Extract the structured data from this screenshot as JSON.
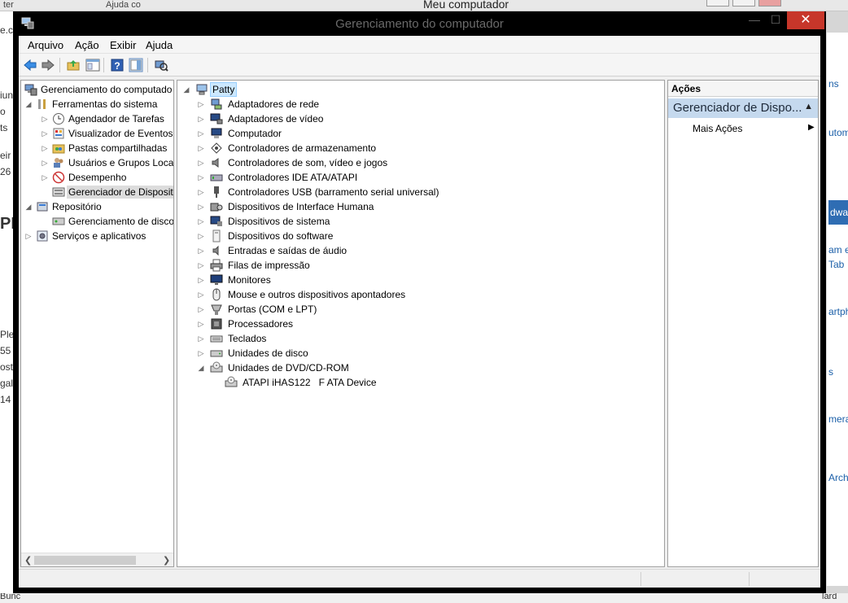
{
  "background": {
    "title": "Meu computador",
    "tabs": [
      "ter",
      "Ajuda co"
    ],
    "left_fragments": [
      "e.c",
      "iun",
      "o",
      "ts",
      "eir",
      "26",
      "PK",
      "Ple",
      "55",
      "ost",
      "gal",
      "14"
    ],
    "right_fragments": [
      "ns",
      "utom",
      "dwa",
      "am e",
      "Tab",
      "artph",
      "s",
      "mera",
      "Arch"
    ],
    "bottom_fragments": [
      "Bunc",
      "lard"
    ]
  },
  "window": {
    "title": "Gerenciamento do computador",
    "close_label": "✕",
    "minimize_label": "—",
    "maximize_label": "☐"
  },
  "menu": [
    "Arquivo",
    "Ação",
    "Exibir",
    "Ajuda"
  ],
  "tree": {
    "root": "Gerenciamento do computado",
    "items": [
      {
        "label": "Ferramentas do sistema",
        "level": 1,
        "exp": "▲",
        "icon": "tools-icon"
      },
      {
        "label": "Agendador de Tarefas",
        "level": 2,
        "exp": "▷",
        "icon": "clock-icon"
      },
      {
        "label": "Visualizador de Eventos",
        "level": 2,
        "exp": "▷",
        "icon": "event-viewer-icon"
      },
      {
        "label": "Pastas compartilhadas",
        "level": 2,
        "exp": "▷",
        "icon": "shared-folder-icon"
      },
      {
        "label": "Usuários e Grupos Loca",
        "level": 2,
        "exp": "▷",
        "icon": "users-icon"
      },
      {
        "label": "Desempenho",
        "level": 2,
        "exp": "▷",
        "icon": "performance-icon"
      },
      {
        "label": "Gerenciador de Disposit",
        "level": 2,
        "exp": "",
        "icon": "device-manager-icon",
        "selected": true
      },
      {
        "label": "Repositório",
        "level": 1,
        "exp": "▲",
        "icon": "storage-icon"
      },
      {
        "label": "Gerenciamento de disco",
        "level": 2,
        "exp": "",
        "icon": "disk-management-icon"
      },
      {
        "label": "Serviços e aplicativos",
        "level": 1,
        "exp": "▷",
        "icon": "services-icon"
      }
    ]
  },
  "devices": {
    "root": "Patty",
    "categories": [
      {
        "label": "Adaptadores de rede",
        "icon": "network-adapter-icon"
      },
      {
        "label": "Adaptadores de vídeo",
        "icon": "display-adapter-icon"
      },
      {
        "label": "Computador",
        "icon": "computer-icon"
      },
      {
        "label": "Controladores de armazenamento",
        "icon": "storage-controller-icon"
      },
      {
        "label": "Controladores de som, vídeo e jogos",
        "icon": "sound-icon"
      },
      {
        "label": "Controladores IDE ATA/ATAPI",
        "icon": "ide-controller-icon"
      },
      {
        "label": "Controladores USB (barramento serial universal)",
        "icon": "usb-icon"
      },
      {
        "label": "Dispositivos de Interface Humana",
        "icon": "hid-icon"
      },
      {
        "label": "Dispositivos de sistema",
        "icon": "system-devices-icon"
      },
      {
        "label": "Dispositivos do software",
        "icon": "software-devices-icon"
      },
      {
        "label": "Entradas e saídas de áudio",
        "icon": "audio-io-icon"
      },
      {
        "label": "Filas de impressão",
        "icon": "printer-icon"
      },
      {
        "label": "Monitores",
        "icon": "monitor-icon"
      },
      {
        "label": "Mouse e outros dispositivos apontadores",
        "icon": "mouse-icon"
      },
      {
        "label": "Portas (COM e LPT)",
        "icon": "port-icon"
      },
      {
        "label": "Processadores",
        "icon": "processor-icon"
      },
      {
        "label": "Teclados",
        "icon": "keyboard-icon"
      },
      {
        "label": "Unidades de disco",
        "icon": "disk-drive-icon"
      },
      {
        "label": "Unidades de DVD/CD-ROM",
        "icon": "dvd-drive-icon",
        "expanded": true
      }
    ],
    "child": "ATAPI iHAS122   F ATA Device"
  },
  "actions": {
    "header": "Ações",
    "section": "Gerenciador de Dispo...",
    "items": [
      "Mais Ações"
    ]
  },
  "colors": {
    "accent": "#c5d9ee",
    "close": "#c7362a",
    "selected_root": "#cce8ff"
  }
}
